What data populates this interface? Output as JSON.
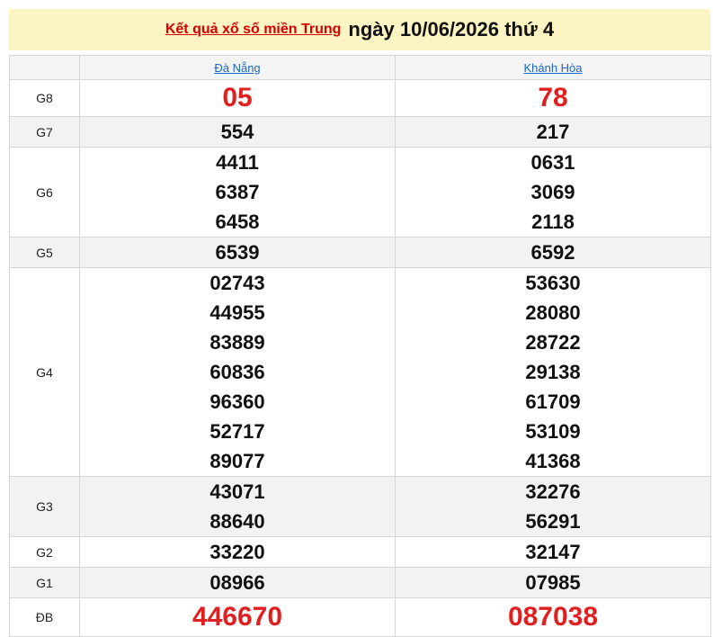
{
  "header": {
    "link_text": "Kết quả xổ số miền Trung",
    "date_text": "ngày 10/06/2026 thứ 4"
  },
  "colors": {
    "header_bg": "#fdf4c3",
    "link_red": "#d60000",
    "province_link_blue": "#1a66c2",
    "special_red": "#e02020",
    "row_alt_bg": "#f2f2f2"
  },
  "columns": [
    "Đà Nẵng",
    "Khánh Hòa"
  ],
  "rows": [
    {
      "label": "G8",
      "values": [
        [
          "05"
        ],
        [
          "78"
        ]
      ]
    },
    {
      "label": "G7",
      "values": [
        [
          "554"
        ],
        [
          "217"
        ]
      ]
    },
    {
      "label": "G6",
      "values": [
        [
          "4411",
          "6387",
          "6458"
        ],
        [
          "0631",
          "3069",
          "2118"
        ]
      ]
    },
    {
      "label": "G5",
      "values": [
        [
          "6539"
        ],
        [
          "6592"
        ]
      ]
    },
    {
      "label": "G4",
      "values": [
        [
          "02743",
          "44955",
          "83889",
          "60836",
          "96360",
          "52717",
          "89077"
        ],
        [
          "53630",
          "28080",
          "28722",
          "29138",
          "61709",
          "53109",
          "41368"
        ]
      ]
    },
    {
      "label": "G3",
      "values": [
        [
          "43071",
          "88640"
        ],
        [
          "32276",
          "56291"
        ]
      ]
    },
    {
      "label": "G2",
      "values": [
        [
          "33220"
        ],
        [
          "32147"
        ]
      ]
    },
    {
      "label": "G1",
      "values": [
        [
          "08966"
        ],
        [
          "07985"
        ]
      ]
    },
    {
      "label": "ĐB",
      "values": [
        [
          "446670"
        ],
        [
          "087038"
        ]
      ]
    }
  ]
}
